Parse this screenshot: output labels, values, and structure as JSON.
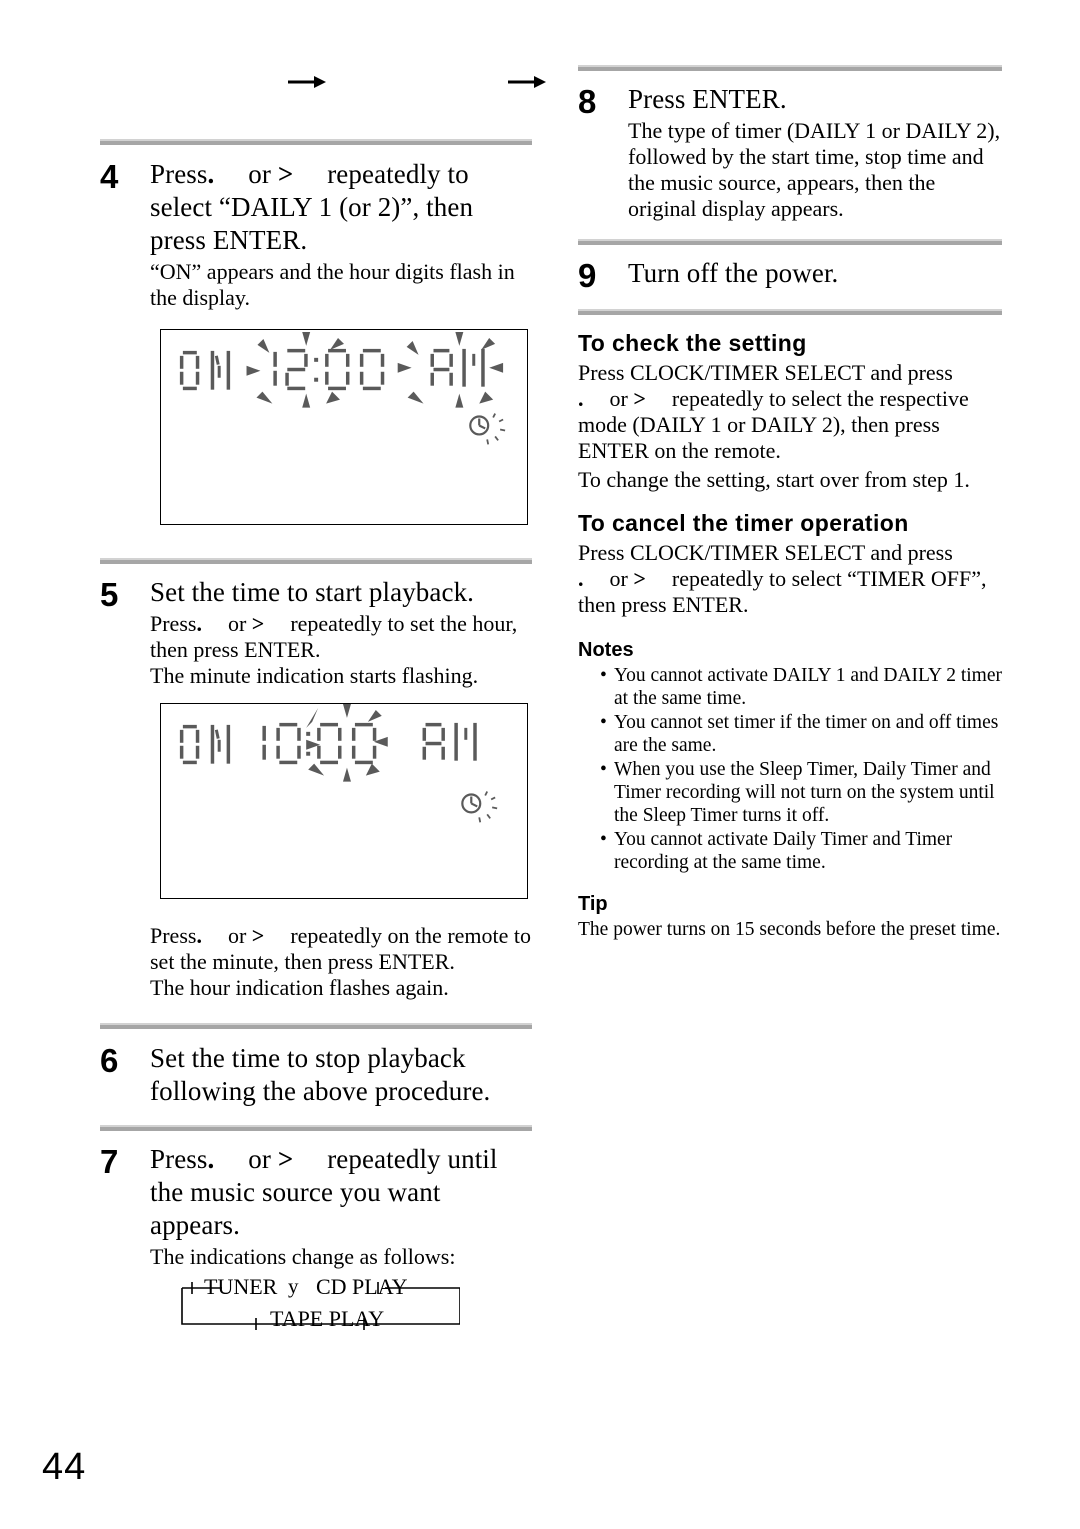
{
  "page": {
    "number": "44",
    "top_arrows": [
      "arrow-right",
      "arrow-right"
    ]
  },
  "left_column": {
    "step4": {
      "number": "4",
      "title_pre": "Press",
      "title_key_a": ".",
      "title_or": "or",
      "title_key_b": ">",
      "title_post": "repeatedly to select “DAILY 1 (or 2)”, then press ENTER.",
      "sub": "“ON” appears and the hour digits flash in the display.",
      "display": {
        "name": "lcd-display-on-1200am",
        "on_label": "ON",
        "hour": "12",
        "colon": ":",
        "minute": "00",
        "meridiem": "AM",
        "flashing": [
          "hour",
          "meridiem"
        ],
        "timer_icon": "clock-flashing-icon"
      }
    },
    "step5": {
      "number": "5",
      "title": "Set the time to start playback.",
      "sub_pre": "Press",
      "sub_key_a": ".",
      "sub_or": "or",
      "sub_key_b": ">",
      "sub_post": "repeatedly to set the hour, then press ENTER.",
      "sub2": "The minute indication starts flashing.",
      "display": {
        "name": "lcd-display-on-1000am",
        "on_label": "ON",
        "hour": "10",
        "colon": ":",
        "minute": "00",
        "meridiem": "AM",
        "flashing": [
          "minute"
        ],
        "timer_icon": "clock-flashing-icon"
      },
      "after_pre": "Press",
      "after_key_a": ".",
      "after_or": "or",
      "after_key_b": ">",
      "after_post": "repeatedly on the remote to set the minute, then press ENTER.",
      "after2": "The hour indication flashes again."
    },
    "step6": {
      "number": "6",
      "title": "Set the time to stop playback following the above procedure."
    },
    "step7": {
      "number": "7",
      "title_pre": "Press",
      "title_key_a": ".",
      "title_or": "or",
      "title_key_b": ">",
      "title_post": "repeatedly until the music source you want appears.",
      "sub": "The indications change as follows:",
      "flow": {
        "items": [
          "TUNER",
          "CD PLAY",
          "TAPE PLAY"
        ],
        "sep_first": "y",
        "tick_left_top": "t",
        "tick_right_top": "T",
        "tick_left_bottom": "t",
        "tick_right_bottom": "T"
      }
    }
  },
  "right_column": {
    "step8": {
      "number": "8",
      "title": "Press ENTER.",
      "sub": "The type of timer (DAILY 1 or DAILY 2), followed by the start time, stop time and the music source, appears, then the original display appears."
    },
    "step9": {
      "number": "9",
      "title": "Turn off the power."
    },
    "check_setting": {
      "heading": "To check the setting",
      "line1": "Press CLOCK/TIMER SELECT and press",
      "key_a": ".",
      "or": "or",
      "key_b": ">",
      "line2_post": "repeatedly to select the respective mode (DAILY 1 or DAILY 2), then press ENTER on the remote.",
      "line3": "To change the setting, start over from step 1."
    },
    "cancel_timer": {
      "heading": "To cancel the timer operation",
      "line1": "Press CLOCK/TIMER SELECT and press",
      "key_a": ".",
      "or": "or",
      "key_b": ">",
      "line2_post": "repeatedly to select “TIMER OFF”, then press ENTER."
    },
    "notes": {
      "heading": "Notes",
      "items": [
        "You cannot activate DAILY 1 and DAILY 2 timer at the same time.",
        "You cannot set timer if the timer on and off times are the same.",
        "When you use the Sleep Timer, Daily Timer and Timer recording will not turn on the system until the Sleep Timer turns it off.",
        "You cannot activate Daily Timer and Timer recording at the same time."
      ]
    },
    "tip": {
      "heading": "Tip",
      "text": "The power turns on 15 seconds before the preset time."
    }
  },
  "colors": {
    "rule": "#a6a6a6",
    "rule_highlight": "#d2d2d2",
    "lcd_segment": "#5a5a5a",
    "text": "#000000"
  }
}
